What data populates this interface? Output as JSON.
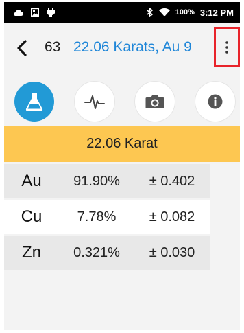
{
  "status_bar": {
    "icons_left": [
      "cloud-icon",
      "gallery-icon",
      "usb-icon"
    ],
    "icons_right": [
      "bluetooth-icon",
      "wifi-icon"
    ],
    "battery": "100%",
    "time": "3:12 PM"
  },
  "header": {
    "sample_number": "63",
    "title": "22.06 Karats, Au 9"
  },
  "toolbar": {
    "buttons": [
      {
        "name": "results-flask-icon",
        "active": true
      },
      {
        "name": "spectrum-icon",
        "active": false
      },
      {
        "name": "camera-icon",
        "active": false
      },
      {
        "name": "info-icon",
        "active": false
      }
    ]
  },
  "karat_banner": "22.06 Karat",
  "results": [
    {
      "element": "Au",
      "percent": "91.90%",
      "error": "± 0.402"
    },
    {
      "element": "Cu",
      "percent": "7.78%",
      "error": "± 0.082"
    },
    {
      "element": "Zn",
      "percent": "0.321%",
      "error": "± 0.030"
    }
  ],
  "colors": {
    "accent": "#1f86d8",
    "active_button": "#229ad6",
    "banner": "#fdc751",
    "highlight_box": "#e8232a"
  }
}
